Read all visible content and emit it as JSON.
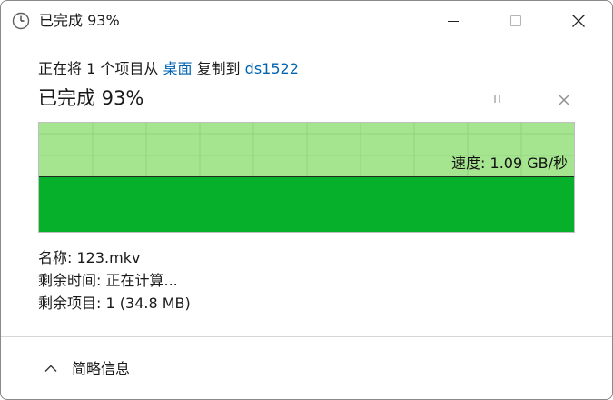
{
  "window": {
    "title": "已完成 93%",
    "icons": {
      "app": "clock-icon",
      "minimize": "minimize-icon",
      "maximize": "maximize-icon",
      "close": "close-icon"
    }
  },
  "operation": {
    "prefix": "正在将 1 个项目从 ",
    "source": "桌面",
    "middle": " 复制到 ",
    "destination": "ds1522",
    "colors": {
      "link": "#0063b1"
    }
  },
  "progress": {
    "status": "已完成 93%",
    "percent": 93,
    "icons": {
      "pause": "pause-icon",
      "cancel": "cancel-icon"
    }
  },
  "speed_graph": {
    "label": "速度:",
    "value": "1.09 GB/秒",
    "colors": {
      "background": "#a6e58f",
      "fill": "#06b02a"
    }
  },
  "details": [
    {
      "label": "名称:",
      "value": "123.mkv"
    },
    {
      "label": "剩余时间:",
      "value": "正在计算..."
    },
    {
      "label": "剩余项目:",
      "value": "1 (34.8 MB)"
    }
  ],
  "toggle": {
    "label": "简略信息",
    "icon": "chevron-up-icon"
  }
}
